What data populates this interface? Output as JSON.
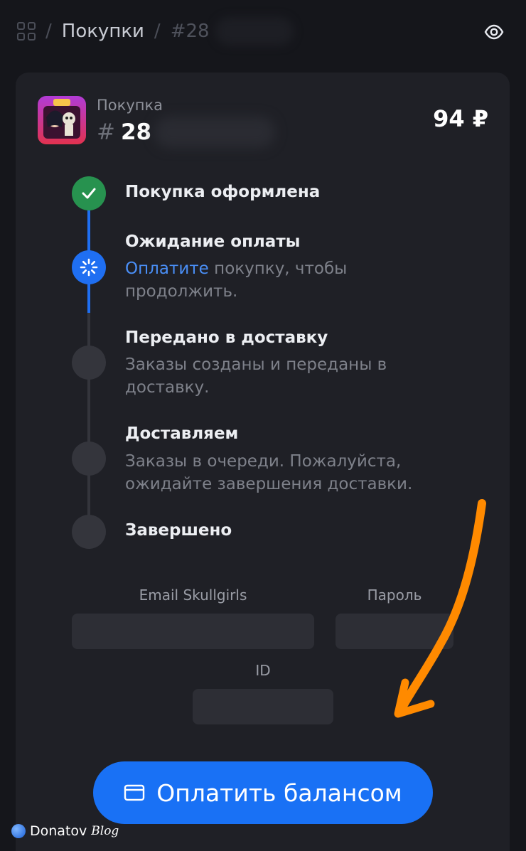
{
  "header": {
    "grid_icon": "grid-icon",
    "crumbs": [
      "Покупки",
      "#28"
    ],
    "separator": "/",
    "eye_icon": "eye-icon"
  },
  "purchase": {
    "label": "Покупка",
    "hash": "#",
    "number_visible": "28",
    "price": "94 ₽"
  },
  "steps": [
    {
      "title": "Покупка оформлена",
      "state": "done",
      "icon": "check-icon"
    },
    {
      "title": "Ожидание оплаты",
      "state": "active",
      "icon": "spinner-icon",
      "link": "Оплатите",
      "desc": " покупку, чтобы продолжить."
    },
    {
      "title": "Передано в доставку",
      "state": "pending",
      "desc": "Заказы созданы и переданы в доставку."
    },
    {
      "title": "Доставляем",
      "state": "pending",
      "desc": "Заказы в очереди. Пожалуйста, ожидайте завершения доставки."
    },
    {
      "title": "Завершено",
      "state": "pending"
    }
  ],
  "form": {
    "email_label": "Email Skullgirls",
    "password_label": "Пароль",
    "id_label": "ID",
    "email_value": "",
    "password_value": "",
    "id_value": ""
  },
  "pay_button": {
    "label": "Оплатить балансом",
    "icon": "wallet-icon"
  },
  "watermark": {
    "brand": "Donatov",
    "suffix": "Blog"
  },
  "colors": {
    "accent": "#1971f5",
    "done": "#27924f",
    "annotation": "#ff8a00",
    "background": "#15161b",
    "card": "#1f2026"
  }
}
